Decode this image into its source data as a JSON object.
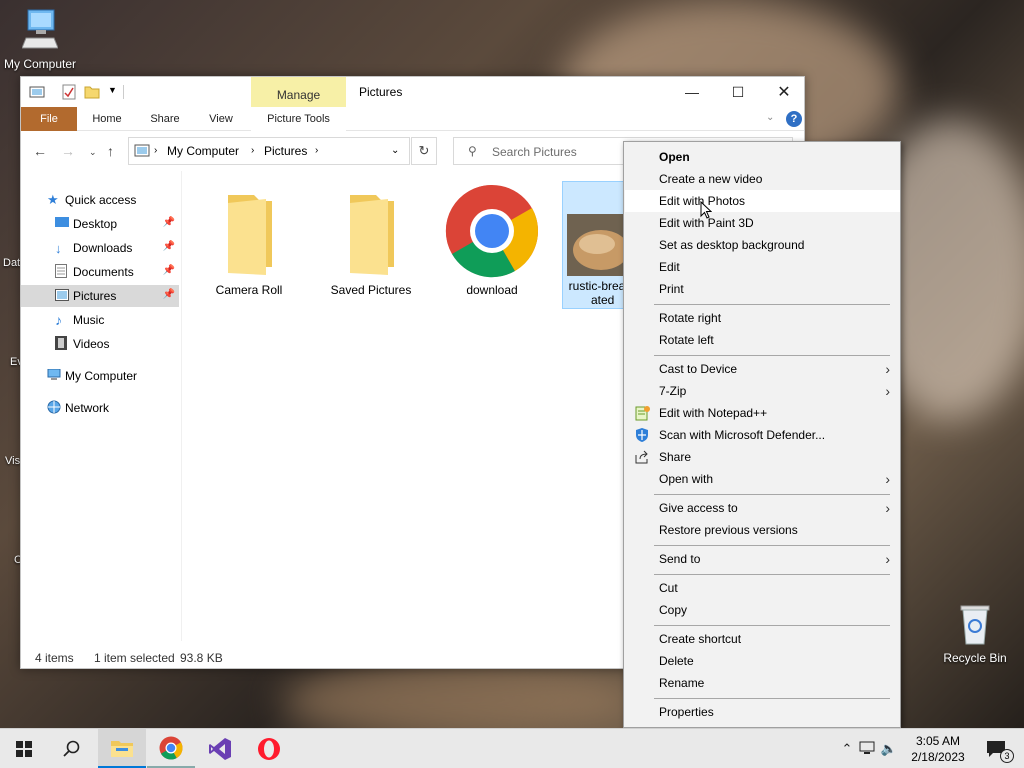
{
  "desktop": {
    "my_computer_label": "My Computer",
    "recycle_bin_label": "Recycle Bin",
    "edge_labels": [
      "Dat",
      "Ev",
      "Vis",
      "C"
    ]
  },
  "explorer": {
    "title": "Pictures",
    "manage_label": "Manage",
    "tabs": {
      "file": "File",
      "home": "Home",
      "share": "Share",
      "view": "View",
      "picture_tools": "Picture Tools"
    },
    "address": {
      "segments": [
        "My Computer",
        "Pictures"
      ]
    },
    "search": {
      "placeholder": "Search Pictures"
    },
    "nav": {
      "quick_access": "Quick access",
      "desktop": "Desktop",
      "downloads": "Downloads",
      "documents": "Documents",
      "pictures": "Pictures",
      "music": "Music",
      "videos": "Videos",
      "my_computer": "My Computer",
      "network": "Network"
    },
    "files": [
      {
        "label": "Camera Roll"
      },
      {
        "label": "Saved Pictures"
      },
      {
        "label": "download"
      },
      {
        "label_line1": "rustic-brea",
        "label_line2": "ated"
      }
    ],
    "status": {
      "item_count": "4 items",
      "selection": "1 item selected",
      "size": "93.8 KB"
    }
  },
  "context_menu": {
    "open": "Open",
    "create_video": "Create a new video",
    "edit_photos": "Edit with Photos",
    "edit_paint3d": "Edit with Paint 3D",
    "set_background": "Set as desktop background",
    "edit": "Edit",
    "print": "Print",
    "rotate_right": "Rotate right",
    "rotate_left": "Rotate left",
    "cast": "Cast to Device",
    "zip": "7-Zip",
    "notepad": "Edit with Notepad++",
    "defender": "Scan with Microsoft Defender...",
    "share": "Share",
    "open_with": "Open with",
    "give_access": "Give access to",
    "restore": "Restore previous versions",
    "send_to": "Send to",
    "cut": "Cut",
    "copy": "Copy",
    "create_shortcut": "Create shortcut",
    "delete": "Delete",
    "rename": "Rename",
    "properties": "Properties"
  },
  "taskbar": {
    "time": "3:05 AM",
    "date": "2/18/2023",
    "notification_count": "3"
  },
  "colors": {
    "file_tab": "#b26a2e",
    "manage_tab": "#f7f0a7",
    "selection": "#cce8ff",
    "accent": "#0078d7"
  }
}
